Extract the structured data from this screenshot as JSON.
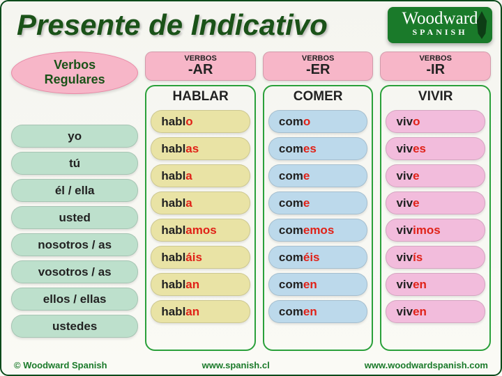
{
  "title": "Presente de Indicativo",
  "logo": {
    "main": "Woodward",
    "sub": "SPANISH"
  },
  "badge": {
    "line1": "Verbos",
    "line2": "Regulares"
  },
  "columns": [
    {
      "key": "ar",
      "head_small": "VERBOS",
      "head_big": "-AR",
      "infinitive": "HABLAR",
      "stem": "habl",
      "endings": [
        "o",
        "as",
        "a",
        "a",
        "amos",
        "áis",
        "an",
        "an"
      ],
      "head_bg": "bg-pink",
      "pill_bg": "bg-yellow"
    },
    {
      "key": "er",
      "head_small": "VERBOS",
      "head_big": "-ER",
      "infinitive": "COMER",
      "stem": "com",
      "endings": [
        "o",
        "es",
        "e",
        "e",
        "emos",
        "éis",
        "en",
        "en"
      ],
      "head_bg": "bg-pink",
      "pill_bg": "bg-blue"
    },
    {
      "key": "ir",
      "head_small": "VERBOS",
      "head_big": "-IR",
      "infinitive": "VIVIR",
      "stem": "viv",
      "endings": [
        "o",
        "es",
        "e",
        "e",
        "imos",
        "ís",
        "en",
        "en"
      ],
      "head_bg": "bg-pink",
      "pill_bg": "bg-rose"
    }
  ],
  "pronouns": [
    "yo",
    "tú",
    "él / ella",
    "usted",
    "nosotros / as",
    "vosotros / as",
    "ellos / ellas",
    "ustedes"
  ],
  "footer": {
    "copyright": "© Woodward Spanish",
    "url1": "www.spanish.cl",
    "url2": "www.woodwardspanish.com"
  }
}
